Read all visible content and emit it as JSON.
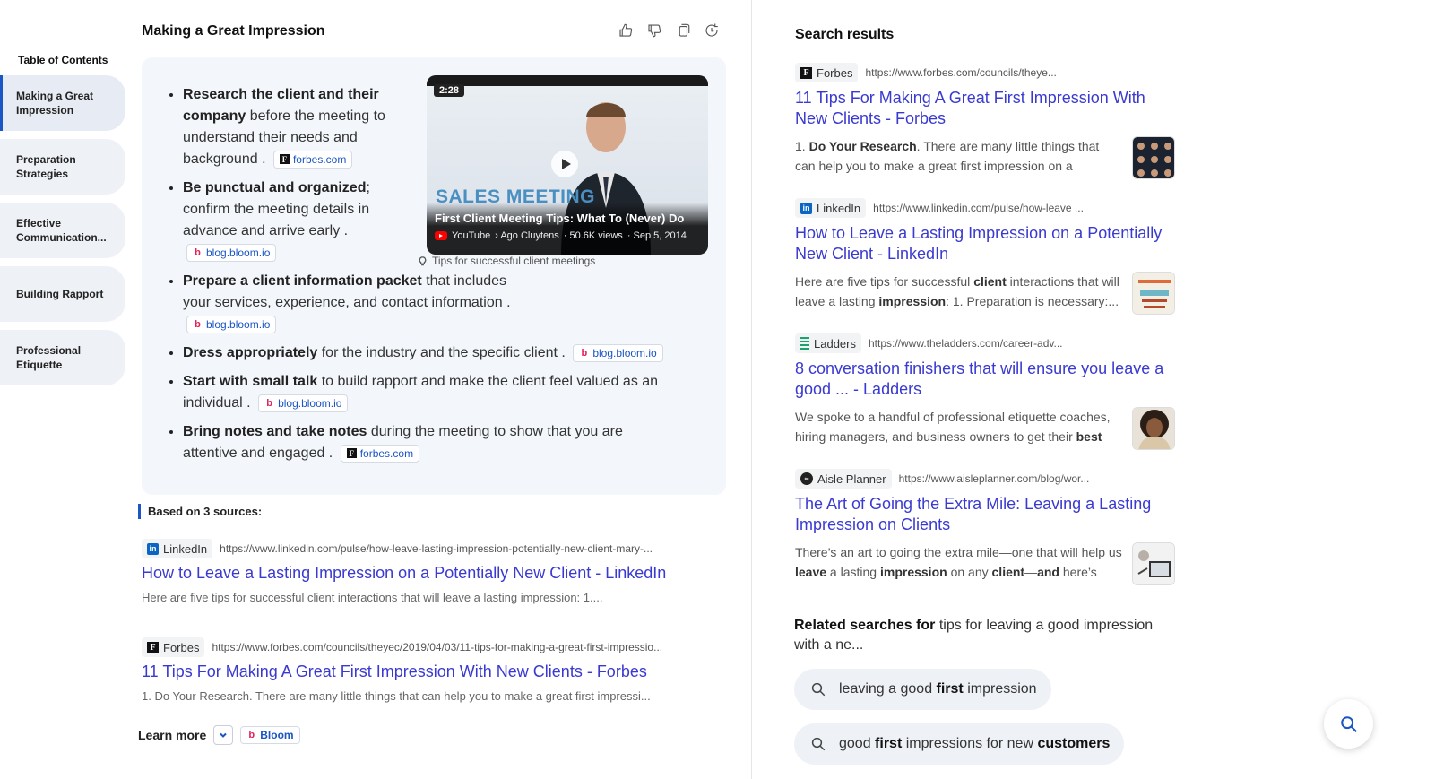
{
  "toc": {
    "title": "Table of Contents",
    "items": [
      {
        "label": "Making a Great Impression",
        "active": true
      },
      {
        "label": "Preparation Strategies",
        "active": false
      },
      {
        "label": "Effective Communication...",
        "active": false
      },
      {
        "label": "Building Rapport",
        "active": false
      },
      {
        "label": "Professional Etiquette",
        "active": false
      }
    ]
  },
  "answer": {
    "title": "Making a Great Impression",
    "actions": [
      "thumbs-up-icon",
      "thumbs-down-icon",
      "copy-icon",
      "regenerate-icon"
    ],
    "bullets": [
      {
        "bold": "Research the client and their company",
        "text": " before the meeting to understand their needs and background .",
        "cite": {
          "logo": "F",
          "label": "forbes.com"
        }
      },
      {
        "bold": "Be punctual and organized",
        "text": "; confirm the meeting details in advance and arrive early .",
        "cite": {
          "logo": "b",
          "label": "blog.bloom.io"
        }
      },
      {
        "bold": "Prepare a client information packet",
        "text": " that includes your services, experience, and contact information .",
        "cite": {
          "logo": "b",
          "label": "blog.bloom.io"
        }
      },
      {
        "bold": "Dress appropriately",
        "text": " for the industry and the specific client .",
        "cite": {
          "logo": "b",
          "label": "blog.bloom.io"
        }
      },
      {
        "bold": "Start with small talk",
        "text": " to build rapport and make the client feel valued as an individual .",
        "cite": {
          "logo": "b",
          "label": "blog.bloom.io"
        }
      },
      {
        "bold": "Bring notes and take notes",
        "text": " during the meeting to show that you are attentive and engaged .",
        "cite": {
          "logo": "F",
          "label": "forbes.com"
        }
      }
    ],
    "video": {
      "duration": "2:28",
      "banner": "SALES MEETING",
      "title": "First Client Meeting Tips: What To (Never) Do",
      "platform": "YouTube",
      "channel": "› Ago Cluytens",
      "views": "· 50.6K views",
      "date": "· Sep 5, 2014",
      "caption": "Tips for successful client meetings"
    }
  },
  "sources": {
    "heading": "Based on 3 sources:",
    "items": [
      {
        "site": "LinkedIn",
        "logo": "in",
        "url": "https://www.linkedin.com/pulse/how-leave-lasting-impression-potentially-new-client-mary-...",
        "title": "How to Leave a Lasting Impression on a Potentially New Client - LinkedIn",
        "snippet": "Here are five tips for successful client interactions that will leave a lasting impression: 1...."
      },
      {
        "site": "Forbes",
        "logo": "F",
        "url": "https://www.forbes.com/councils/theyec/2019/04/03/11-tips-for-making-a-great-first-impressio...",
        "title": "11 Tips For Making A Great First Impression With New Clients - Forbes",
        "snippet": "1. Do Your Research. There are many little things that can help you to make a great first impressi..."
      }
    ],
    "learn_more": "Learn more",
    "learn_more_source": "Bloom"
  },
  "search_results": {
    "heading": "Search results",
    "items": [
      {
        "site": "Forbes",
        "url": "https://www.forbes.com/councils/theye...",
        "title": "11 Tips For Making A Great First Impression With New Clients - Forbes",
        "snippet_html": [
          "1. ",
          "Do Your Research",
          ". There are many little things that can help you to make a great first impression on a potential ne..."
        ]
      },
      {
        "site": "LinkedIn",
        "url": "https://www.linkedin.com/pulse/how-leave ...",
        "title": "How to Leave a Lasting Impression on a Potentially New Client - LinkedIn",
        "snippet_html": [
          "Here are five tips for successful ",
          "client",
          " interactions that will leave a lasting ",
          "impression",
          ": 1. Preparation is necessary:..."
        ]
      },
      {
        "site": "Ladders",
        "url": "https://www.theladders.com/career-adv...",
        "title": "8 conversation finishers that will ensure you leave a good ... - Ladders",
        "snippet_html": [
          "We spoke to a handful of professional etiquette coaches, hiring managers, and business owners to get their ",
          "best tip",
          "..."
        ]
      },
      {
        "site": "Aisle Planner",
        "url": "https://www.aisleplanner.com/blog/wor...",
        "title": "The Art of Going the Extra Mile: Leaving a Lasting Impression on Clients",
        "snippet_html": [
          "There’s an art to going the extra mile—one that will help us ",
          "leave",
          " a lasting ",
          "impression",
          " on any ",
          "client",
          "—",
          "and",
          " here’s ho..."
        ]
      }
    ],
    "related_label_bold": "Related searches for",
    "related_label_rest": " tips for leaving a good impression with a ne...",
    "related": [
      {
        "parts": [
          "leaving a good ",
          "first",
          " impression"
        ]
      },
      {
        "parts": [
          "good ",
          "first",
          " impressions for new ",
          "customers"
        ]
      }
    ]
  },
  "colors": {
    "accent": "#1a56c4",
    "link": "#3a3ad0",
    "card_bg": "#f3f6fa",
    "chip_bg": "#eef1f6"
  }
}
